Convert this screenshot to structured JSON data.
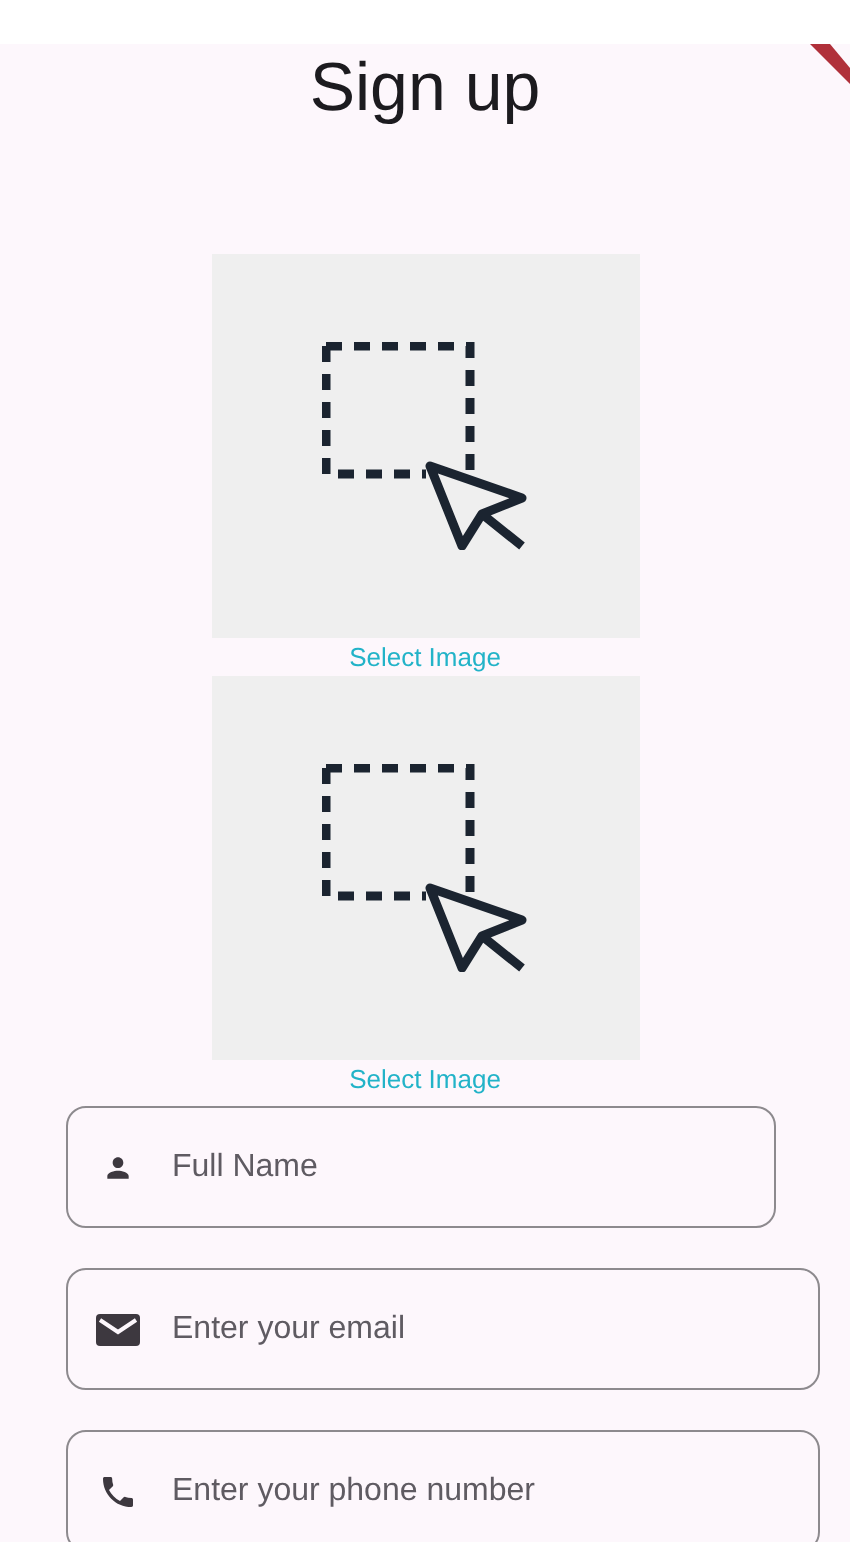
{
  "title": "Sign up",
  "image_pickers": [
    {
      "label": "Select Image"
    },
    {
      "label": "Select Image"
    }
  ],
  "fields": [
    {
      "kind": "name",
      "placeholder": "Full Name"
    },
    {
      "kind": "email",
      "placeholder": "Enter your email"
    },
    {
      "kind": "phone",
      "placeholder": "Enter your phone number"
    }
  ]
}
